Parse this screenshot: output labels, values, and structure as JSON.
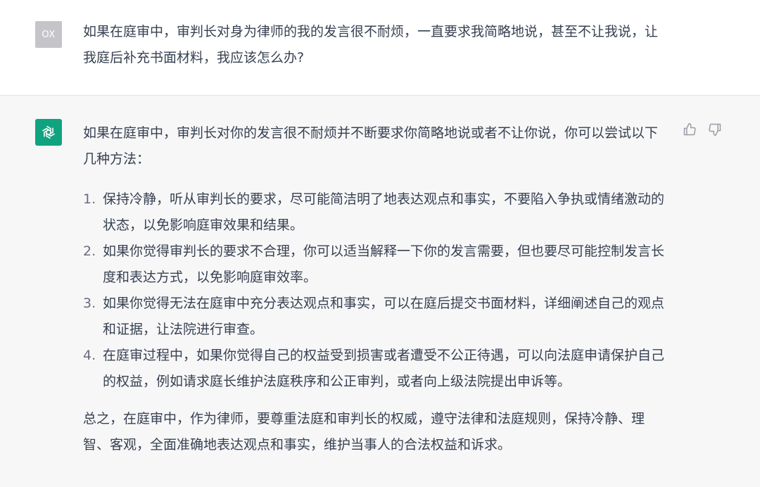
{
  "user": {
    "avatar_text": "OX",
    "message": "如果在庭审中，审判长对身为律师的我的发言很不耐烦，一直要求我简略地说，甚至不让我说，让我庭后补充书面材料，我应该怎么办?"
  },
  "assistant": {
    "avatar_icon": "openai-logo-icon",
    "intro": "如果在庭审中，审判长对你的发言很不耐烦并不断要求你简略地说或者不让你说，你可以尝试以下几种方法：",
    "items": [
      {
        "num": "1.",
        "text": "保持冷静，听从审判长的要求，尽可能简洁明了地表达观点和事实，不要陷入争执或情绪激动的状态，以免影响庭审效果和结果。"
      },
      {
        "num": "2.",
        "text": "如果你觉得审判长的要求不合理，你可以适当解释一下你的发言需要，但也要尽可能控制发言长度和表达方式，以免影响庭审效率。"
      },
      {
        "num": "3.",
        "text": "如果你觉得无法在庭审中充分表达观点和事实，可以在庭后提交书面材料，详细阐述自己的观点和证据，让法院进行审查。"
      },
      {
        "num": "4.",
        "text": "在庭审过程中，如果你觉得自己的权益受到损害或者遭受不公正待遇，可以向法庭申请保护自己的权益，例如请求庭长维护法庭秩序和公正审判，或者向上级法院提出申诉等。"
      }
    ],
    "summary": "总之，在庭审中，作为律师，要尊重法庭和审判长的权威，遵守法律和法庭规则，保持冷静、理智、客观，全面准确地表达观点和事实，维护当事人的合法权益和诉求。"
  },
  "feedback": {
    "like_icon": "thumbs-up-icon",
    "dislike_icon": "thumbs-down-icon"
  },
  "colors": {
    "accent": "#10a37f",
    "assistant_bg": "#f7f7f8",
    "user_avatar_bg": "#c5c5c9",
    "text": "#374151"
  }
}
